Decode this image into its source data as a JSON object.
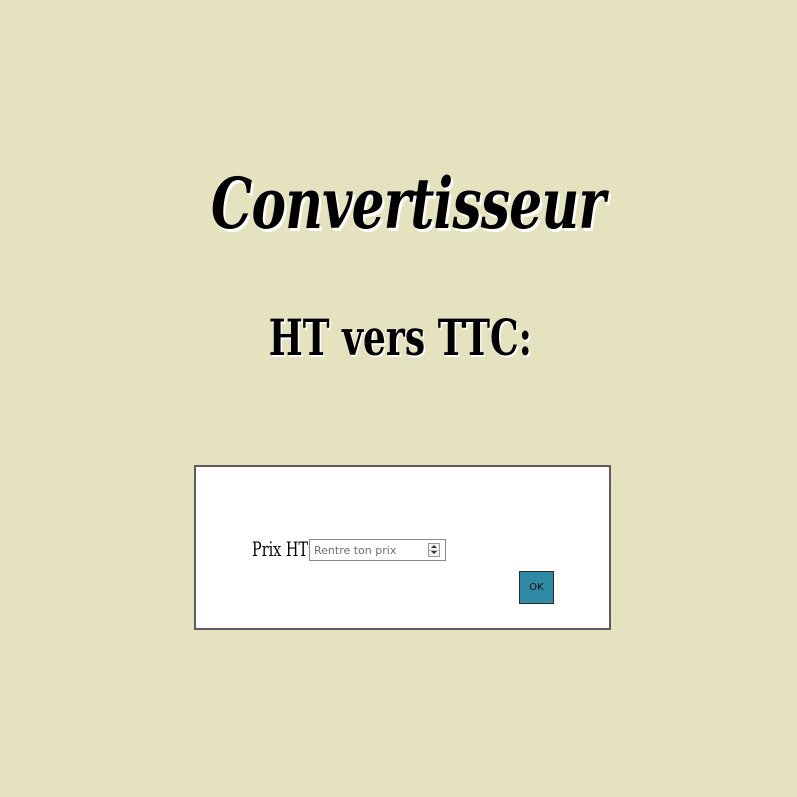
{
  "header": {
    "title": "Convertisseur",
    "subtitle": "HT vers TTC:"
  },
  "form": {
    "price_label": "Prix HT:",
    "price_input": {
      "placeholder": "Rentre ton prix",
      "value": ""
    },
    "submit_label": "OK"
  },
  "colors": {
    "background": "#e5e2c0",
    "form_background": "#ffffff",
    "form_border": "#5e5a62",
    "button": "#2f8aa6"
  },
  "icons": {
    "spinner_up": "chevron-up-icon",
    "spinner_down": "chevron-down-icon"
  }
}
